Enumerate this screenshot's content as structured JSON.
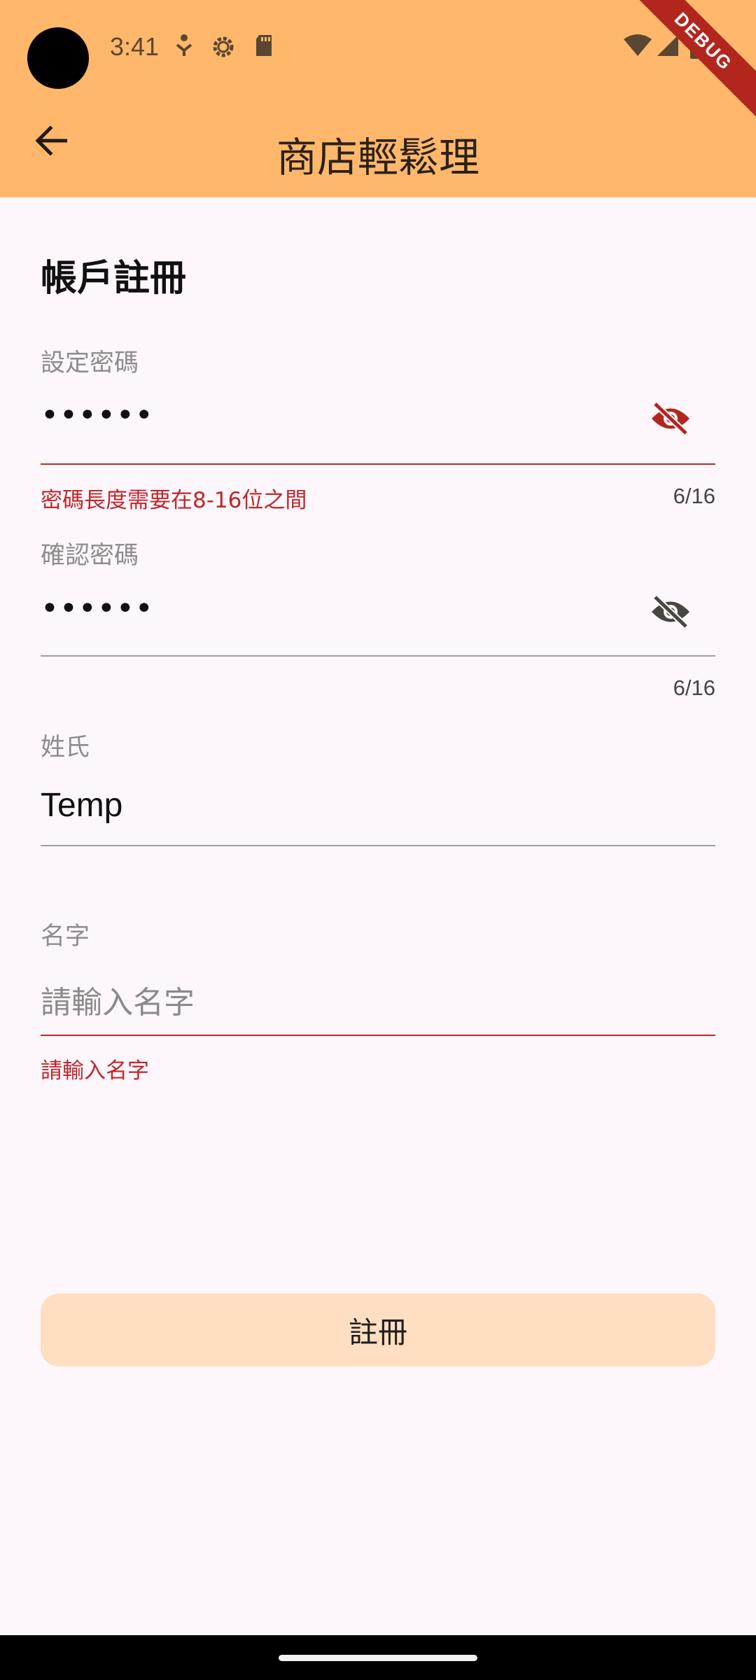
{
  "status_bar": {
    "time": "3:41",
    "icons_left": [
      "accessibility-icon",
      "settings-gear-icon",
      "sd-card-icon"
    ],
    "icons_right": [
      "wifi-icon",
      "cell-signal-icon",
      "battery-icon"
    ],
    "debug_banner": "DEBUG"
  },
  "app_bar": {
    "title": "商店輕鬆理",
    "back_icon": "arrow-back-icon",
    "color": "#ffb86b"
  },
  "form": {
    "heading": "帳戶註冊",
    "set_password": {
      "label": "設定密碼",
      "value": "••••••",
      "error": "密碼長度需要在8-16位之間",
      "counter": "6/16",
      "icon": "visibility-off-icon"
    },
    "confirm_password": {
      "label": "確認密碼",
      "value": "••••••",
      "counter": "6/16",
      "icon": "visibility-off-icon"
    },
    "surname": {
      "label": "姓氏",
      "value": "Temp"
    },
    "given_name": {
      "label": "名字",
      "placeholder": "請輸入名字",
      "error": "請輸入名字"
    },
    "submit_label": "註冊"
  },
  "colors": {
    "error": "#c0262d",
    "button": "#ffdec1",
    "background": "#fdf7fb"
  }
}
